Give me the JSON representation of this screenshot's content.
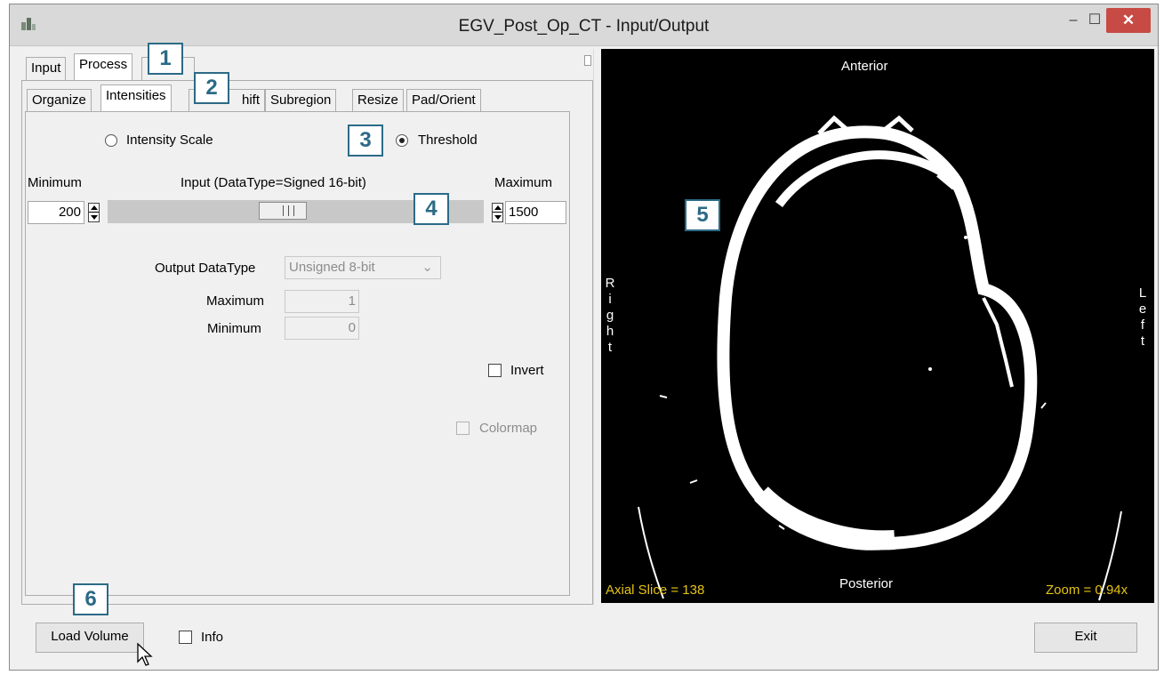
{
  "window": {
    "title": "EGV_Post_Op_CT - Input/Output",
    "minimize": "–",
    "maximize": "☐",
    "close": "✕"
  },
  "top_tabs": [
    {
      "label": "Input"
    },
    {
      "label": "Process"
    }
  ],
  "sub_tabs": [
    {
      "label": "Organize"
    },
    {
      "label": "Intensities"
    },
    {
      "label": "hift"
    },
    {
      "label": "Subregion"
    },
    {
      "label": "Resize"
    },
    {
      "label": "Pad/Orient"
    }
  ],
  "mode": {
    "intensity_scale_label": "Intensity Scale",
    "threshold_label": "Threshold",
    "selected": "Threshold"
  },
  "range": {
    "minimum_label": "Minimum",
    "maximum_label": "Maximum",
    "input_label": "Input (DataType=Signed 16-bit)",
    "min_value": "200",
    "max_value": "1500",
    "slider_position_fraction": 0.46
  },
  "output": {
    "datatype_label": "Output DataType",
    "datatype_value": "Unsigned 8-bit",
    "maximum_label": "Maximum",
    "maximum_value": "1",
    "minimum_label": "Minimum",
    "minimum_value": "0",
    "invert_label": "Invert",
    "colormap_label": "Colormap"
  },
  "viewer": {
    "top": "Anterior",
    "bottom": "Posterior",
    "left": "Right",
    "right": "Left",
    "slice": "Axial Slice = 138",
    "zoom": "Zoom = 0.94x"
  },
  "footer": {
    "load_volume": "Load Volume",
    "info_label": "Info",
    "exit": "Exit"
  },
  "callouts": [
    "1",
    "2",
    "3",
    "4",
    "5",
    "6"
  ],
  "colors": {
    "callout": "#2c6a86",
    "overlay_text": "#e5c312",
    "close_button": "#c74a44"
  }
}
